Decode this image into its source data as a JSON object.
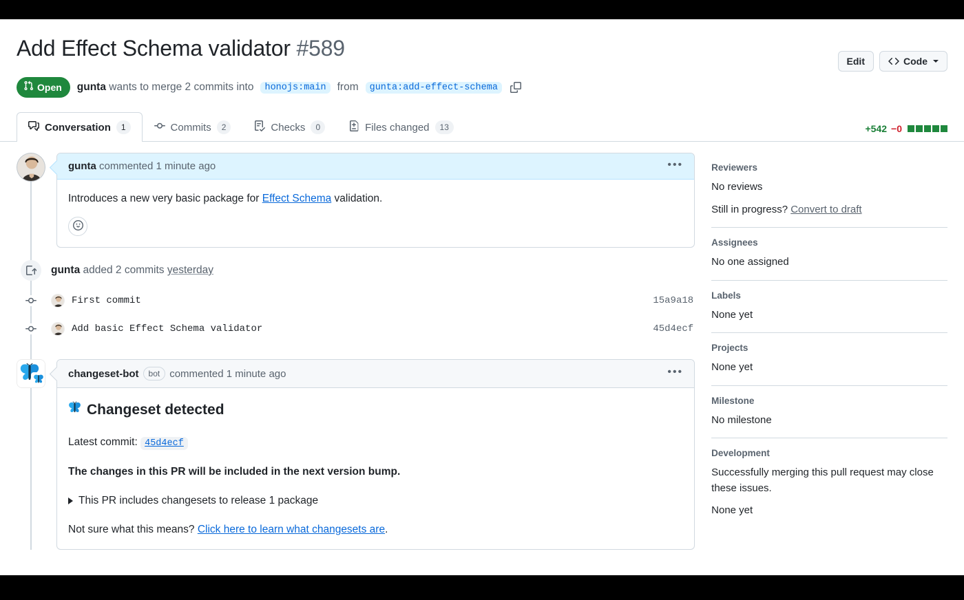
{
  "header": {
    "title": "Add Effect Schema validator",
    "number": "#589",
    "edit_label": "Edit",
    "code_label": "Code",
    "state": "Open",
    "author": "gunta",
    "meta_prefix": "wants to merge 2 commits into",
    "base_branch": "honojs:main",
    "from_word": "from",
    "head_branch": "gunta:add-effect-schema"
  },
  "tabs": [
    {
      "label": "Conversation",
      "count": "1",
      "icon": "comment-discussion-icon",
      "active": true
    },
    {
      "label": "Commits",
      "count": "2",
      "icon": "git-commit-icon",
      "active": false
    },
    {
      "label": "Checks",
      "count": "0",
      "icon": "checklist-icon",
      "active": false
    },
    {
      "label": "Files changed",
      "count": "13",
      "icon": "file-diff-icon",
      "active": false
    }
  ],
  "diffstat": {
    "additions": "+542",
    "deletions": "−0",
    "blocks": 5
  },
  "comments": [
    {
      "author": "gunta",
      "action": "commented 1 minute ago",
      "body_before_link": "Introduces a new very basic package for ",
      "body_link": "Effect Schema",
      "body_after_link": " validation."
    }
  ],
  "commits_group": {
    "author": "gunta",
    "text": "added 2 commits",
    "when": "yesterday",
    "items": [
      {
        "message": "First commit",
        "sha": "15a9a18"
      },
      {
        "message": "Add basic Effect Schema validator",
        "sha": "45d4ecf"
      }
    ]
  },
  "bot_comment": {
    "author": "changeset-bot",
    "badge": "bot",
    "action": "commented 1 minute ago",
    "heading": "Changeset detected",
    "latest_commit_label": "Latest commit:",
    "latest_commit_sha": "45d4ecf",
    "bump_note": "The changes in this PR will be included in the next version bump.",
    "details_summary": "This PR includes changesets to release 1 package",
    "footer_text": "Not sure what this means? ",
    "footer_link": "Click here to learn what changesets are",
    "footer_period": "."
  },
  "sidebar": [
    {
      "title": "Reviewers",
      "lines": [
        "No reviews"
      ],
      "prompt_text": "Still in progress? ",
      "prompt_link": "Convert to draft"
    },
    {
      "title": "Assignees",
      "lines": [
        "No one assigned"
      ]
    },
    {
      "title": "Labels",
      "lines": [
        "None yet"
      ]
    },
    {
      "title": "Projects",
      "lines": [
        "None yet"
      ]
    },
    {
      "title": "Milestone",
      "lines": [
        "No milestone"
      ]
    },
    {
      "title": "Development",
      "lines": [
        "Successfully merging this pull request may close these issues.",
        "None yet"
      ]
    }
  ],
  "colors": {
    "open_green": "#1f883d",
    "link_blue": "#0969da",
    "addition_green": "#1a7f37",
    "deletion_red": "#cf222e",
    "author_header_bg": "#ddf4ff"
  }
}
